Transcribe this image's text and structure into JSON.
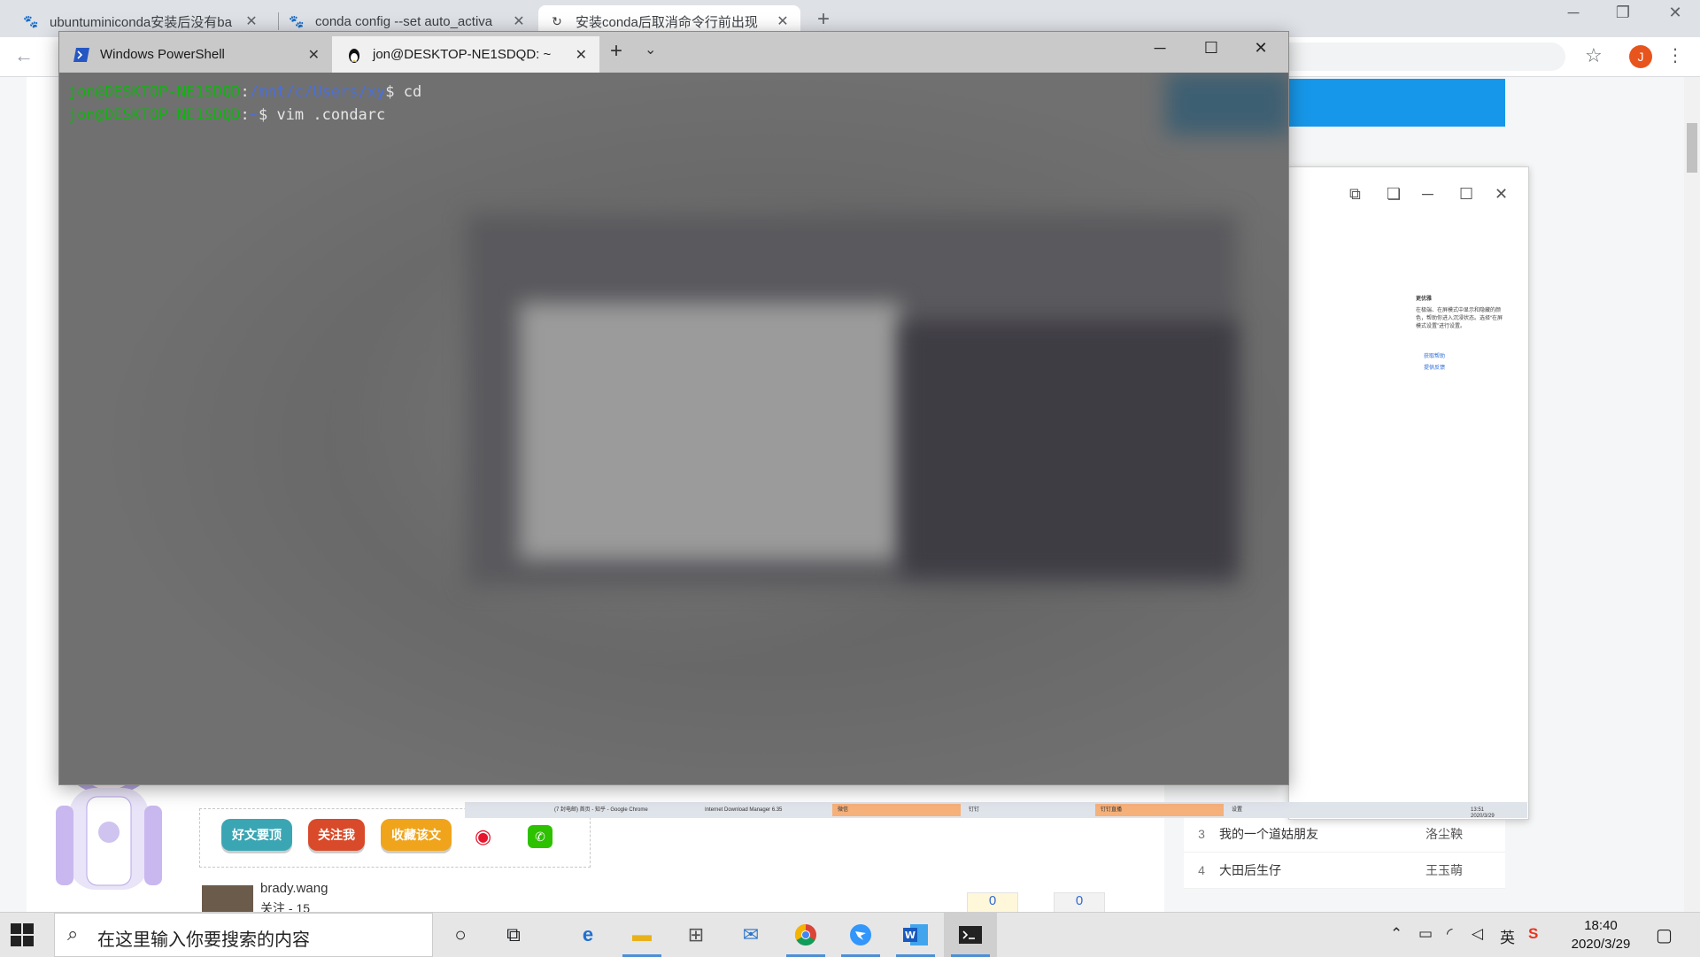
{
  "chrome": {
    "tabs": [
      {
        "title": "ubuntuminiconda安装后没有ba",
        "icon": "baidu-icon"
      },
      {
        "title": "conda config --set auto_activa",
        "icon": "baidu-icon"
      },
      {
        "title": "安装conda后取消命令行前出现",
        "icon": "csdn-icon"
      }
    ],
    "avatar_letter": "J"
  },
  "terminal": {
    "tabs": [
      {
        "title": "Windows PowerShell",
        "icon": "powershell-icon"
      },
      {
        "title": "jon@DESKTOP-NE1SDQD: ~",
        "icon": "linux-tux-icon"
      }
    ],
    "lines": [
      {
        "user": "jon@DESKTOP-NE1SDQD",
        "sep": ":",
        "path": "/mnt/c/Users/xy",
        "cmd": "$ cd"
      },
      {
        "user": "jon@DESKTOP-NE1SDQD",
        "sep": ":",
        "path": "~",
        "cmd": "$ vim .condarc"
      }
    ]
  },
  "blog": {
    "share_buttons": [
      {
        "label": "好文要顶",
        "color": "#3aa6b3"
      },
      {
        "label": "关注我",
        "color": "#d84a2a"
      },
      {
        "label": "收藏该文",
        "color": "#f0a41b"
      }
    ],
    "author": {
      "name": "brady.wang",
      "follow": "关注 - 15"
    },
    "counts": [
      "0",
      "0"
    ],
    "ranking": [
      {
        "rank": "3",
        "title": "我的一个道姑朋友",
        "author": "洛尘鞅"
      },
      {
        "rank": "4",
        "title": "大田后生仔",
        "author": "王玉萌"
      }
    ]
  },
  "snip": {
    "title": "更优雅",
    "desc": "在极端、在屏模式中显示和隐藏的颜色，帮助你进入沉浸状态。选择“在屏模式设置”进行设置。",
    "links": [
      "获取帮助",
      "提供反馈"
    ]
  },
  "mini_taskbar": {
    "items": [
      "(7 封电邮) 首页 - 知乎 - Google Chrome",
      "Internet Download Manager 6.35",
      "微信",
      "钉钉",
      "钉钉直播",
      "设置"
    ],
    "clock_time": "13:51",
    "clock_date": "2020/3/29"
  },
  "taskbar": {
    "search_placeholder": "在这里输入你要搜索的内容",
    "ime": "英",
    "time": "18:40",
    "date": "2020/3/29"
  }
}
